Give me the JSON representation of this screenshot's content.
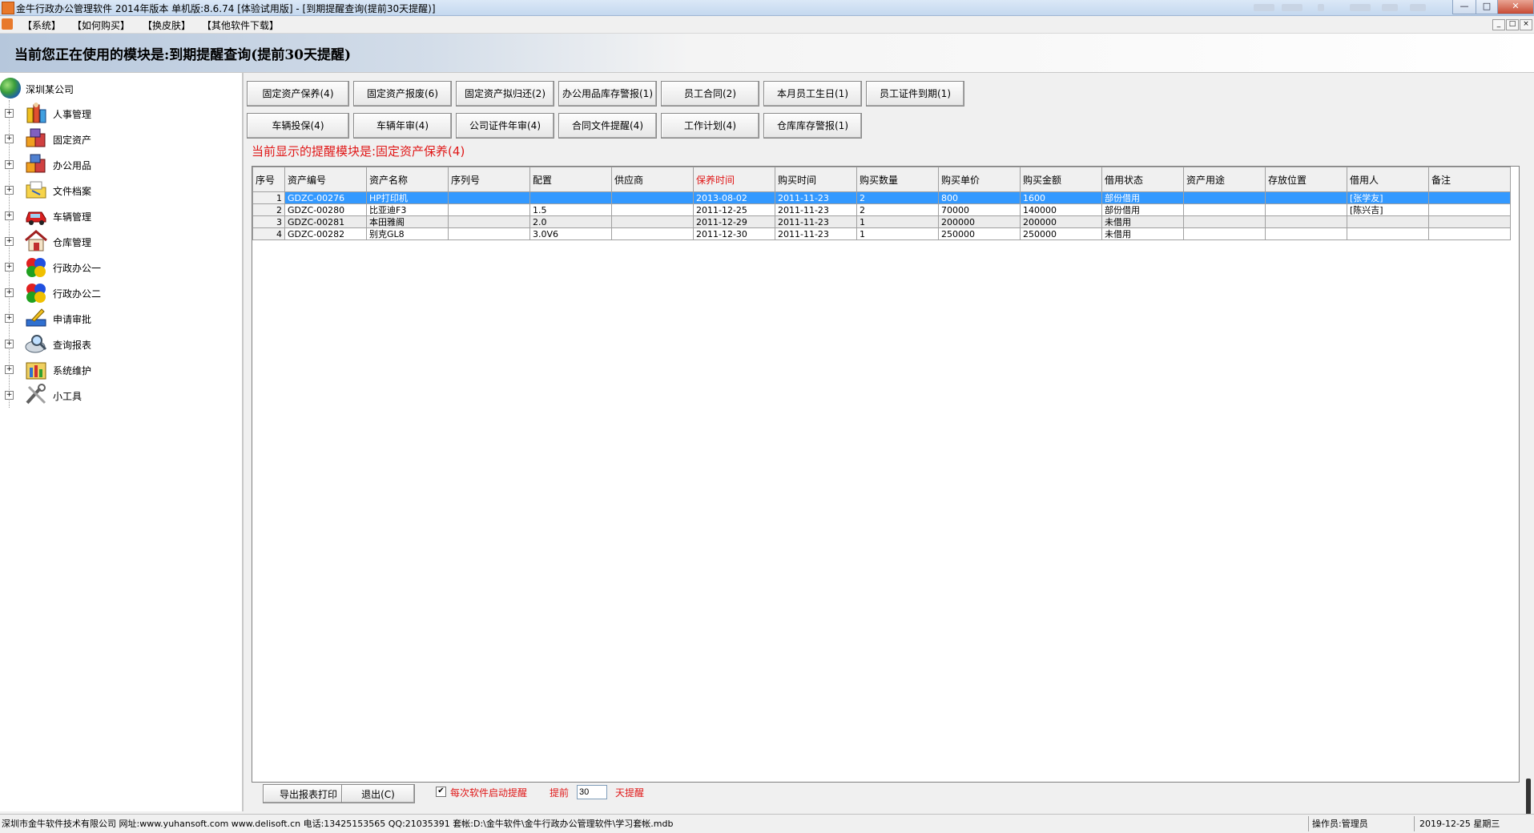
{
  "window": {
    "title": "金牛行政办公管理软件 2014年版本 单机版:8.6.74 [体验试用版] - [到期提醒查询(提前30天提醒)]"
  },
  "menu": [
    "【系统】",
    "【如何购买】",
    "【换皮肤】",
    "【其他软件下载】"
  ],
  "module_title": "当前您正在使用的模块是:到期提醒查询(提前30天提醒)",
  "tree": {
    "root": "深圳某公司",
    "items": [
      {
        "label": "人事管理",
        "icon": "personnel-icon"
      },
      {
        "label": "固定资产",
        "icon": "fixed-assets-icon"
      },
      {
        "label": "办公用品",
        "icon": "office-supplies-icon"
      },
      {
        "label": "文件档案",
        "icon": "file-archive-icon"
      },
      {
        "label": "车辆管理",
        "icon": "vehicle-icon"
      },
      {
        "label": "仓库管理",
        "icon": "warehouse-icon"
      },
      {
        "label": "行政办公一",
        "icon": "admin-office-1-icon"
      },
      {
        "label": "行政办公二",
        "icon": "admin-office-2-icon"
      },
      {
        "label": "申请审批",
        "icon": "approval-icon"
      },
      {
        "label": "查询报表",
        "icon": "report-icon"
      },
      {
        "label": "系统维护",
        "icon": "maintenance-icon"
      },
      {
        "label": "小工具",
        "icon": "tools-icon"
      }
    ]
  },
  "reminder_buttons_row1": [
    "固定资产保养(4)",
    "固定资产报废(6)",
    "固定资产拟归还(2)",
    "办公用品库存警报(1)",
    "员工合同(2)",
    "本月员工生日(1)",
    "员工证件到期(1)"
  ],
  "reminder_buttons_row2": [
    "车辆投保(4)",
    "车辆年审(4)",
    "公司证件年审(4)",
    "合同文件提醒(4)",
    "工作计划(4)",
    "仓库库存警报(1)"
  ],
  "current_reminder": "当前显示的提醒模块是:固定资产保养(4)",
  "table": {
    "columns": [
      "序号",
      "资产编号",
      "资产名称",
      "序列号",
      "配置",
      "供应商",
      "保养时间",
      "购买时间",
      "购买数量",
      "购买单价",
      "购买金额",
      "借用状态",
      "资产用途",
      "存放位置",
      "借用人",
      "备注"
    ],
    "highlight_column": "保养时间",
    "rows": [
      [
        "1",
        "GDZC-00276",
        "HP打印机",
        "",
        "",
        "",
        "2013-08-02",
        "2011-11-23",
        "2",
        "800",
        "1600",
        "部份借用",
        "",
        "",
        "[张学友]",
        ""
      ],
      [
        "2",
        "GDZC-00280",
        "比亚迪F3",
        "",
        "1.5",
        "",
        "2011-12-25",
        "2011-11-23",
        "2",
        "70000",
        "140000",
        "部份借用",
        "",
        "",
        "[陈兴吉]",
        ""
      ],
      [
        "3",
        "GDZC-00281",
        "本田雅阁",
        "",
        "2.0",
        "",
        "2011-12-29",
        "2011-11-23",
        "1",
        "200000",
        "200000",
        "未借用",
        "",
        "",
        "",
        ""
      ],
      [
        "4",
        "GDZC-00282",
        "别克GL8",
        "",
        "3.0V6",
        "",
        "2011-12-30",
        "2011-11-23",
        "1",
        "250000",
        "250000",
        "未借用",
        "",
        "",
        "",
        ""
      ]
    ],
    "selected_row": 0
  },
  "bottom": {
    "export_label": "导出报表打印",
    "exit_label": "退出(C)",
    "startup_remind_label": "每次软件启动提醒",
    "startup_remind_checked": true,
    "advance_prefix": "提前",
    "advance_days": "30",
    "advance_suffix": "天提醒"
  },
  "status": {
    "company_info": "深圳市金牛软件技术有限公司 网址:www.yuhansoft.com www.delisoft.cn 电话:13425153565 QQ:21035391 套帐:D:\\金牛软件\\金牛行政办公管理软件\\学习套帐.mdb",
    "operator": "操作员:管理员",
    "date": "2019-12-25 星期三"
  }
}
